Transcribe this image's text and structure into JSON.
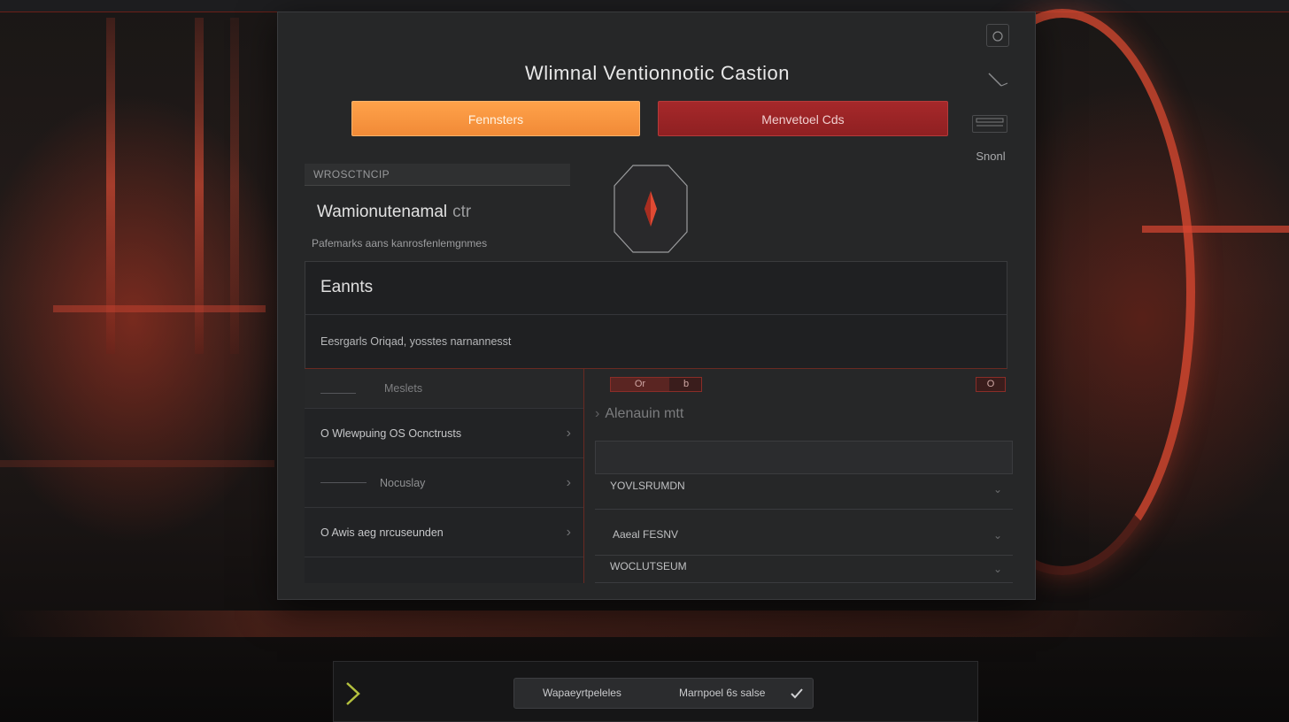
{
  "panel": {
    "title": "Wlimnal Ventionnotic Castion",
    "primary_button": "Fennsters",
    "secondary_button": "Menvetoel Cds"
  },
  "tools": {
    "label": "Snonl"
  },
  "info": {
    "header": "WROSCTNCIP",
    "name": "Wamionutenamal",
    "name_suffix": "ctr",
    "description": "Pafemarks aans kanrosfenlemgnmes"
  },
  "events": {
    "title": "Eannts",
    "description": "Eesrgarls Oriqad, yosstes narnannesst"
  },
  "left_list": {
    "header": "Meslets",
    "items": [
      {
        "label": "O Wlewpuing OS Ocnctrusts"
      },
      {
        "label": "Nocuslay"
      },
      {
        "label": "O Awis aeg nrcuseunden"
      }
    ]
  },
  "right_area": {
    "chip_a": "Or",
    "chip_b": "b",
    "chip_round": "O",
    "title": "Alenauin mtt",
    "rows": [
      {
        "label": "YOVLSRUMDN"
      },
      {
        "label": "Aaeal FESNV"
      },
      {
        "label": "WOCLUTSEUM"
      }
    ]
  },
  "bottom_bar": {
    "option_a": "Wapaeyrtpeleles",
    "option_b": "Marnpoel 6s salse"
  },
  "colors": {
    "accent_orange": "#f18a37",
    "accent_red": "#8f2022",
    "arrow_green": "#b4c13e"
  }
}
